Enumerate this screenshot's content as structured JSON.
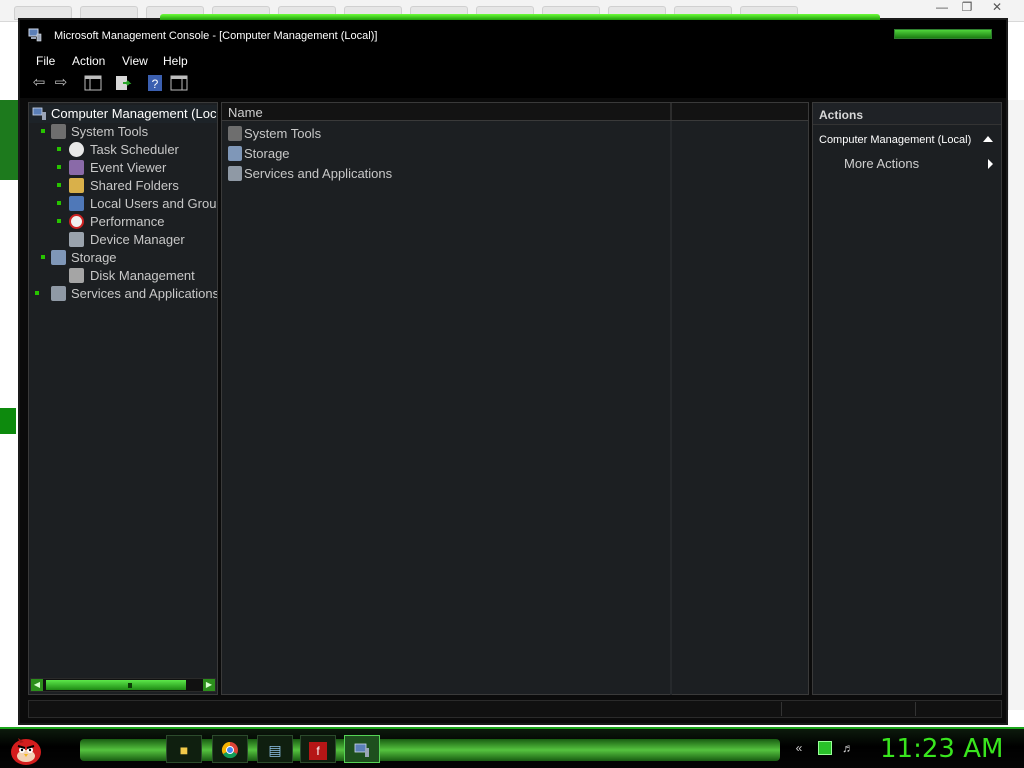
{
  "window": {
    "title": "Microsoft Management Console - [Computer Management (Local)]"
  },
  "menu": {
    "items": [
      "File",
      "Action",
      "View",
      "Help"
    ]
  },
  "toolbar": {
    "icons": [
      "back-arrow-icon",
      "forward-arrow-icon",
      "show-hide-console-tree-icon",
      "export-list-icon",
      "help-icon",
      "show-hide-action-pane-icon"
    ]
  },
  "tree": {
    "root": "Computer Management (Loc",
    "items": [
      {
        "label": "System Tools",
        "level": 1,
        "icon": "tools-icon",
        "bullet": true
      },
      {
        "label": "Task Scheduler",
        "level": 2,
        "icon": "clock-icon",
        "bullet": true
      },
      {
        "label": "Event Viewer",
        "level": 2,
        "icon": "event-viewer-icon",
        "bullet": true
      },
      {
        "label": "Shared Folders",
        "level": 2,
        "icon": "shared-folders-icon",
        "bullet": true
      },
      {
        "label": "Local Users and Grou",
        "level": 2,
        "icon": "local-users-icon",
        "bullet": true
      },
      {
        "label": "Performance",
        "level": 2,
        "icon": "performance-icon",
        "bullet": true
      },
      {
        "label": "Device Manager",
        "level": 2,
        "icon": "device-manager-icon",
        "bullet": false
      },
      {
        "label": "Storage",
        "level": 1,
        "icon": "storage-icon",
        "bullet": true
      },
      {
        "label": "Disk Management",
        "level": 2,
        "icon": "disk-icon",
        "bullet": false
      },
      {
        "label": "Services and Applications",
        "level": 1,
        "icon": "services-icon",
        "bullet": true
      }
    ]
  },
  "list": {
    "column_header": "Name",
    "rows": [
      {
        "label": "System Tools",
        "icon": "tools-icon"
      },
      {
        "label": "Storage",
        "icon": "storage-icon"
      },
      {
        "label": "Services and Applications",
        "icon": "services-icon"
      }
    ]
  },
  "actions": {
    "header": "Actions",
    "section": "Computer Management (Local)",
    "items": [
      "More Actions"
    ]
  },
  "taskbar": {
    "clock": "11:23 AM",
    "accent": "#39e51e"
  }
}
